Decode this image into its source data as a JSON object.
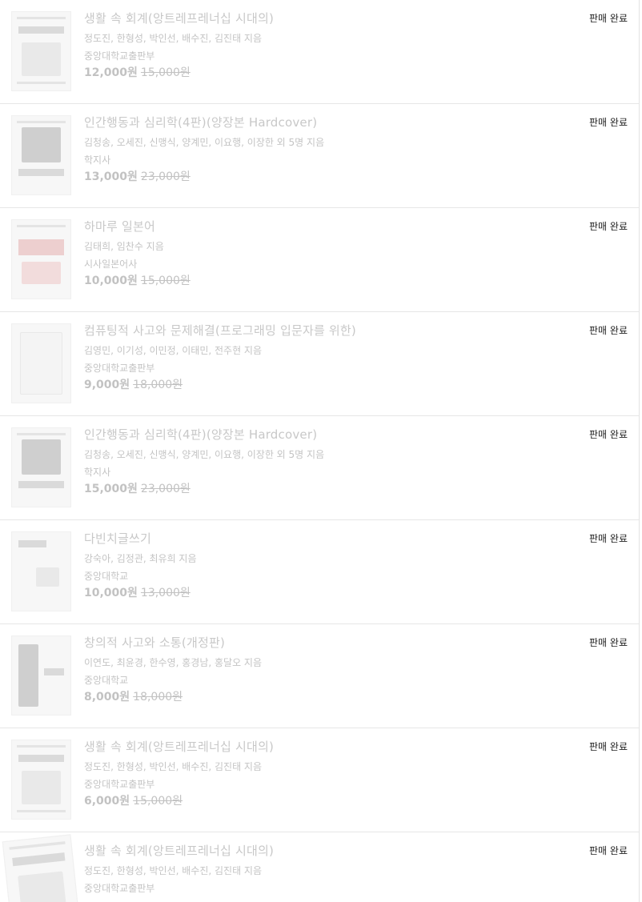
{
  "items": [
    {
      "title": "생활 속 회계(앙트레프레너십 시대의)",
      "authors": "정도진, 한형성, 박인선, 배수진, 김진태 지음",
      "publisher": "중앙대학교출판부",
      "price": "12,000원",
      "original_price": "15,000원",
      "status": "판매 완료",
      "cover_icon": "book-cover-accounting"
    },
    {
      "title": "인간행동과 심리학(4판)(양장본 Hardcover)",
      "authors": "김청송, 오세진, 신맹식, 양계민, 이요행, 이장한 외 5명 지음",
      "publisher": "학지사",
      "price": "13,000원",
      "original_price": "23,000원",
      "status": "판매 완료",
      "cover_icon": "book-cover-psychology"
    },
    {
      "title": "하마루 일본어",
      "authors": "김태희, 임찬수 지음",
      "publisher": "시사일본어사",
      "price": "10,000원",
      "original_price": "15,000원",
      "status": "판매 완료",
      "cover_icon": "book-cover-japanese"
    },
    {
      "title": "컴퓨팅적 사고와 문제해결(프로그래밍 입문자를 위한)",
      "authors": "김영민, 이기성, 이민정, 이태민, 전주현 지음",
      "publisher": "중앙대학교출판부",
      "price": "9,000원",
      "original_price": "18,000원",
      "status": "판매 완료",
      "cover_icon": "book-cover-computing"
    },
    {
      "title": "인간행동과 심리학(4판)(양장본 Hardcover)",
      "authors": "김청송, 오세진, 신맹식, 양계민, 이요행, 이장한 외 5명 지음",
      "publisher": "학지사",
      "price": "15,000원",
      "original_price": "23,000원",
      "status": "판매 완료",
      "cover_icon": "book-cover-psychology"
    },
    {
      "title": "다빈치글쓰기",
      "authors": "강숙아, 김정관, 최유희 지음",
      "publisher": "중앙대학교",
      "price": "10,000원",
      "original_price": "13,000원",
      "status": "판매 완료",
      "cover_icon": "book-cover-writing"
    },
    {
      "title": "창의적 사고와 소통(개정판)",
      "authors": "이연도, 최윤경, 한수영, 홍경남, 홍달오 지음",
      "publisher": "중앙대학교",
      "price": "8,000원",
      "original_price": "18,000원",
      "status": "판매 완료",
      "cover_icon": "book-cover-creative"
    },
    {
      "title": "생활 속 회계(앙트레프레너십 시대의)",
      "authors": "정도진, 한형성, 박인선, 배수진, 김진태 지음",
      "publisher": "중앙대학교출판부",
      "price": "6,000원",
      "original_price": "15,000원",
      "status": "판매 완료",
      "cover_icon": "book-cover-accounting"
    },
    {
      "title": "생활 속 회계(앙트레프레너십 시대의)",
      "authors": "정도진, 한형성, 박인선, 배수진, 김진태 지음",
      "publisher": "중앙대학교출판부",
      "price": "",
      "original_price": "",
      "status": "판매 완료",
      "cover_icon": "book-cover-accounting"
    }
  ],
  "colors": {
    "faded_text": "#c4c4c4",
    "status_text": "#222222",
    "divider": "#e6e6e6"
  }
}
